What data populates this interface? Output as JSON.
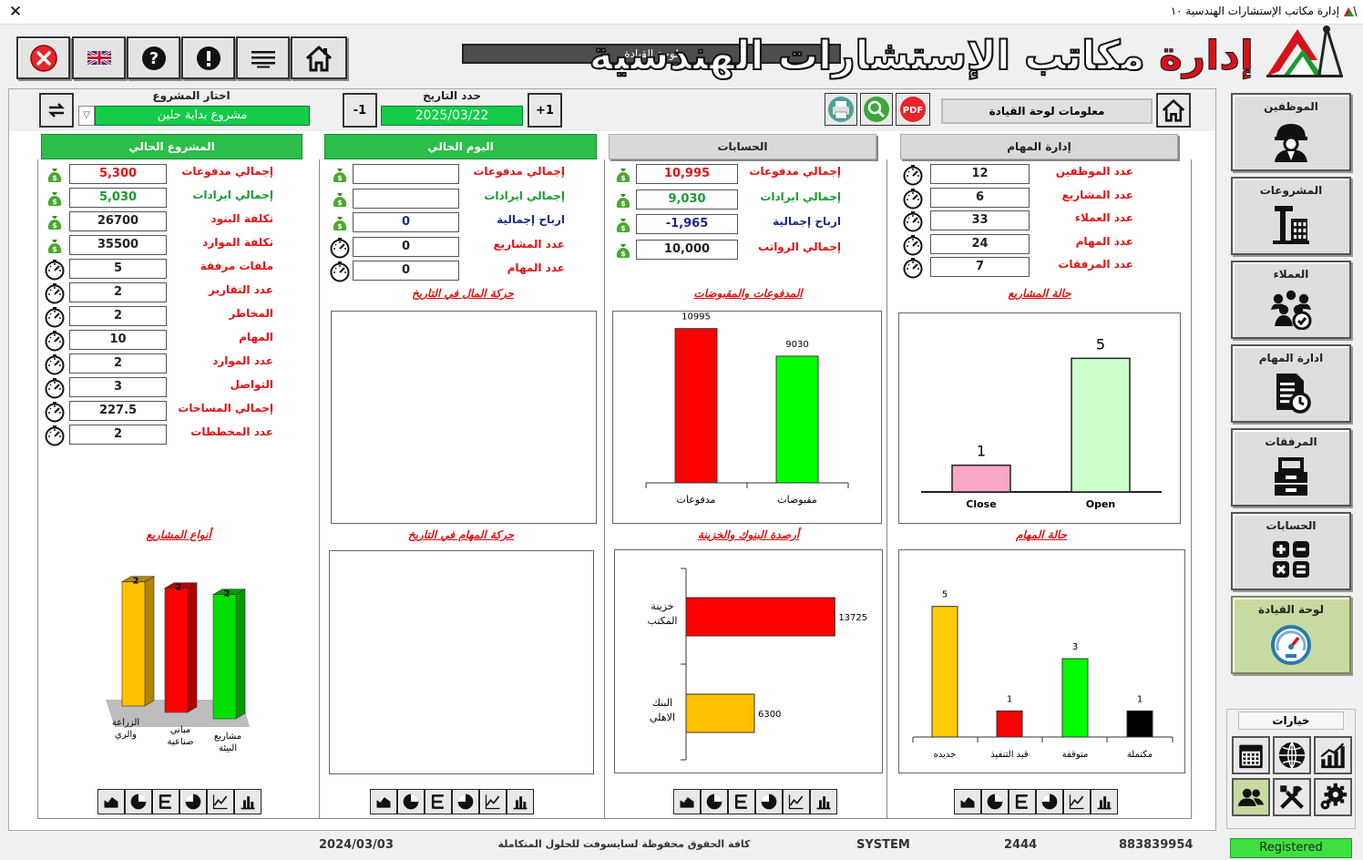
{
  "window": {
    "title": "إدارة مكاتب الإستشارات الهندسية ١٠"
  },
  "app": {
    "logo_word1": "إدارة",
    "logo_word2": "مكاتب الإستشارات الهندسية",
    "dashboard_label": "لوحة القيادة"
  },
  "toolbar": {
    "items": [
      "close",
      "language-uk",
      "help",
      "info",
      "menu",
      "home"
    ]
  },
  "topbar": {
    "project_label": "اختار المشروع",
    "project_value": "مشروع بداية حلين",
    "date_label": "حدد التاريخ",
    "date_value": "2025/03/22",
    "minus_label": "-1",
    "plus_label": "+1",
    "info_label": "معلومات لوحة القيادة"
  },
  "panels": {
    "current_project": {
      "header": "المشروع الحالي",
      "rows": [
        {
          "label": "إجمالي مدفوعات",
          "value": "5,300",
          "icon": "money-bag-icon",
          "color": "#e01414",
          "vcolor": "#e01414"
        },
        {
          "label": "إجمالي ايرادات",
          "value": "5,030",
          "icon": "money-bag-icon",
          "color": "#1a9a30",
          "vcolor": "#1a9a30"
        },
        {
          "label": "تكلفة البنود",
          "value": "26700",
          "icon": "money-bag-icon",
          "color": "#e01414",
          "vcolor": "#222"
        },
        {
          "label": "تكلفة الموارد",
          "value": "35500",
          "icon": "money-bag-icon",
          "color": "#e01414",
          "vcolor": "#222"
        },
        {
          "label": "ملفات مرفقة",
          "value": "5",
          "icon": "gauge-icon",
          "color": "#e01414",
          "vcolor": "#222"
        },
        {
          "label": "عدد التقارير",
          "value": "2",
          "icon": "gauge-icon",
          "color": "#e01414",
          "vcolor": "#222"
        },
        {
          "label": "المخاطر",
          "value": "2",
          "icon": "gauge-icon",
          "color": "#e01414",
          "vcolor": "#222"
        },
        {
          "label": "المهام",
          "value": "10",
          "icon": "gauge-icon",
          "color": "#e01414",
          "vcolor": "#222"
        },
        {
          "label": "عدد الموارد",
          "value": "2",
          "icon": "gauge-icon",
          "color": "#e01414",
          "vcolor": "#222"
        },
        {
          "label": "التواصل",
          "value": "3",
          "icon": "gauge-icon",
          "color": "#e01414",
          "vcolor": "#222"
        },
        {
          "label": "إجمالي المساحات",
          "value": "227.5",
          "icon": "gauge-icon",
          "color": "#e01414",
          "vcolor": "#222"
        },
        {
          "label": "عدد المخططات",
          "value": "2",
          "icon": "gauge-icon",
          "color": "#e01414",
          "vcolor": "#222"
        }
      ]
    },
    "current_day": {
      "header": "اليوم الحالي",
      "rows": [
        {
          "label": "إجمالي مدفوعات",
          "value": "",
          "icon": "money-bag-icon",
          "color": "#e01414",
          "vcolor": "#222"
        },
        {
          "label": "إجمالي ايرادات",
          "value": "",
          "icon": "money-bag-icon",
          "color": "#1a9a30",
          "vcolor": "#222"
        },
        {
          "label": "ارباح إجمالية",
          "value": "0",
          "icon": "money-bag-icon",
          "color": "#1a2a8a",
          "vcolor": "#1a2a8a"
        },
        {
          "label": "عدد المشاريع",
          "value": "0",
          "icon": "gauge-icon",
          "color": "#e01414",
          "vcolor": "#222"
        },
        {
          "label": "عدد المهام",
          "value": "0",
          "icon": "gauge-icon",
          "color": "#e01414",
          "vcolor": "#222"
        }
      ]
    },
    "accounts": {
      "header": "الحسابات",
      "rows": [
        {
          "label": "إجمالي مدفوعات",
          "value": "10,995",
          "icon": "money-bag-icon",
          "color": "#e01414",
          "vcolor": "#e01414"
        },
        {
          "label": "إجمالي ايرادات",
          "value": "9,030",
          "icon": "money-bag-icon",
          "color": "#1a9a30",
          "vcolor": "#1a9a30"
        },
        {
          "label": "ارباح إجمالية",
          "value": "-1,965",
          "icon": "money-bag-icon",
          "color": "#1a2a8a",
          "vcolor": "#1a2a8a"
        },
        {
          "label": "إجمالي الرواتب",
          "value": "10,000",
          "icon": "money-bag-icon",
          "color": "#e01414",
          "vcolor": "#222"
        }
      ]
    },
    "tasks_mgmt": {
      "header": "إدارة المهام",
      "rows": [
        {
          "label": "عدد الموظفين",
          "value": "12",
          "icon": "gauge-icon",
          "color": "#e01414",
          "vcolor": "#222"
        },
        {
          "label": "عدد المشاريع",
          "value": "6",
          "icon": "gauge-icon",
          "color": "#e01414",
          "vcolor": "#222"
        },
        {
          "label": "عدد العملاء",
          "value": "33",
          "icon": "gauge-icon",
          "color": "#e01414",
          "vcolor": "#222"
        },
        {
          "label": "عدد المهام",
          "value": "24",
          "icon": "gauge-icon",
          "color": "#e01414",
          "vcolor": "#222"
        },
        {
          "label": "عدد المرفقات",
          "value": "7",
          "icon": "gauge-icon",
          "color": "#e01414",
          "vcolor": "#222"
        }
      ]
    }
  },
  "chart_titles": {
    "money_movement": "حركة المال في التاريخ",
    "payments": "المدفوعات والمقبوضات",
    "project_status": "حالة المشاريع",
    "project_types": "أنواع المشاريع",
    "task_movement": "حركة المهام في التاريخ",
    "bank_balances": "أرصدة البنوك والخزينة",
    "task_status": "حالة المهام"
  },
  "chart_data": [
    {
      "id": "payments",
      "type": "bar",
      "categories": [
        "مدفوعات",
        "مقبوضات"
      ],
      "values": [
        10995,
        9030
      ],
      "colors": [
        "#ff0000",
        "#00ff00"
      ],
      "title": "المدفوعات والمقبوضات",
      "ylim": [
        0,
        12000
      ]
    },
    {
      "id": "project_status",
      "type": "bar",
      "categories": [
        "Close",
        "Open"
      ],
      "values": [
        1,
        5
      ],
      "colors": [
        "#f9a6c9",
        "#ccffcc"
      ],
      "title": "حالة المشاريع",
      "ylim": [
        0,
        6
      ]
    },
    {
      "id": "project_types",
      "type": "bar",
      "categories": [
        "الزراعة والري",
        "مباني صناعية",
        "مشاريع البيئة"
      ],
      "values": [
        2,
        2,
        2
      ],
      "colors": [
        "#ffc000",
        "#ff0000",
        "#00e000"
      ],
      "title": "أنواع المشاريع",
      "ylim": [
        0,
        2.2
      ]
    },
    {
      "id": "bank_balances",
      "type": "bar",
      "orientation": "horizontal",
      "categories": [
        "خزينة المكتب",
        "البنك الاهلي"
      ],
      "values": [
        13725,
        6300
      ],
      "colors": [
        "#ff0000",
        "#ffc000"
      ],
      "title": "أرصدة البنوك والخزينة",
      "xlim": [
        0,
        15000
      ]
    },
    {
      "id": "task_status",
      "type": "bar",
      "categories": [
        "جديده",
        "قيد التنفيذ",
        "متوقفة",
        "مكتملة"
      ],
      "values": [
        5,
        1,
        3,
        1
      ],
      "colors": [
        "#ffcc00",
        "#ff0000",
        "#00ff00",
        "#000000"
      ],
      "title": "حالة المهام",
      "ylim": [
        0,
        6
      ]
    }
  ],
  "nav": [
    {
      "label": "الموظفين",
      "icon": "engineer-icon",
      "active": false
    },
    {
      "label": "المشروعات",
      "icon": "construction-icon",
      "active": false
    },
    {
      "label": "العملاء",
      "icon": "clients-icon",
      "active": false
    },
    {
      "label": "ادارة المهام",
      "icon": "task-doc-icon",
      "active": false
    },
    {
      "label": "المرفقات",
      "icon": "inbox-tray-icon",
      "active": false
    },
    {
      "label": "الحسابات",
      "icon": "calculator-icon",
      "active": false
    },
    {
      "label": "لوحة القيادة",
      "icon": "speedometer-icon",
      "active": true
    }
  ],
  "options": {
    "label": "خيارات",
    "items": [
      "calendar-icon",
      "globe-icon",
      "growth-chart-icon",
      "users-icon",
      "tools-icon",
      "settings-icon"
    ]
  },
  "footer": {
    "date": "2024/03/03",
    "copyright": "كافة الحقوق محفوظة لسايسوفت للحلول المتكاملة",
    "user": "SYSTEM",
    "code": "2444",
    "serial": "883839954",
    "status": "Registered"
  }
}
